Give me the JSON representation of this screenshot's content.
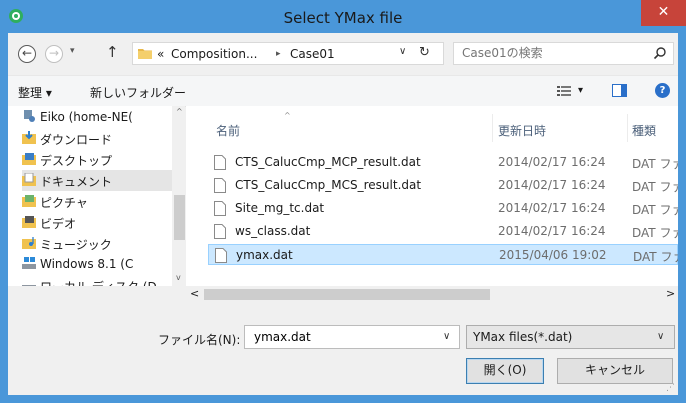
{
  "window": {
    "title": "Select YMax file",
    "close_glyph": "✕",
    "accent": "#4a97d9",
    "close_color": "#c7443a"
  },
  "nav": {
    "back_glyph": "←",
    "forward_glyph": "→",
    "recent_glyph": "▾",
    "up_glyph": "↑"
  },
  "address": {
    "overflow": "«",
    "crumbs": [
      "Composition...",
      "Case01"
    ],
    "separator": "▸",
    "dropdown_glyph": "∨",
    "refresh_glyph": "↻"
  },
  "search": {
    "placeholder": "Case01の検索"
  },
  "command_bar": {
    "organize_label": "整理 ▾",
    "new_folder_label": "新しいフォルダー",
    "view_dropdown_glyph": "▾",
    "help_glyph": "?"
  },
  "sidebar": {
    "items": [
      {
        "label": "Eiko (home-NE(",
        "icon": "network-user-icon"
      },
      {
        "label": "ダウンロード",
        "icon": "downloads-folder-icon"
      },
      {
        "label": "デスクトップ",
        "icon": "desktop-folder-icon"
      },
      {
        "label": "ドキュメント",
        "icon": "documents-folder-icon",
        "selected": true
      },
      {
        "label": "ピクチャ",
        "icon": "pictures-folder-icon"
      },
      {
        "label": "ビデオ",
        "icon": "videos-folder-icon"
      },
      {
        "label": "ミュージック",
        "icon": "music-folder-icon"
      },
      {
        "label": "Windows 8.1 (C",
        "icon": "drive-icon"
      },
      {
        "label": "ローカル ディスク (D",
        "icon": "drive-icon"
      }
    ],
    "scroll_up": "^",
    "scroll_down": "v"
  },
  "file_list": {
    "columns": {
      "name": "名前",
      "date": "更新日時",
      "type": "種類"
    },
    "sort_glyph": "^",
    "files": [
      {
        "name": "CTS_CalucCmp_MCP_result.dat",
        "date": "2014/02/17 16:24",
        "type": "DAT ファイ"
      },
      {
        "name": "CTS_CalucCmp_MCS_result.dat",
        "date": "2014/02/17 16:24",
        "type": "DAT ファイ"
      },
      {
        "name": "Site_mg_tc.dat",
        "date": "2014/02/17 16:24",
        "type": "DAT ファイ"
      },
      {
        "name": "ws_class.dat",
        "date": "2014/02/17 16:24",
        "type": "DAT ファイ"
      },
      {
        "name": "ymax.dat",
        "date": "2015/04/06 19:02",
        "type": "DAT ファイ",
        "selected": true
      }
    ],
    "scroll_left": "<",
    "scroll_right": ">"
  },
  "footer": {
    "filename_label": "ファイル名(N):",
    "filename_value": "ymax.dat",
    "filename_dropdown": "∨",
    "filetype_value": "YMax files(*.dat)",
    "filetype_dropdown": "∨",
    "open_label": "開く(O)",
    "cancel_label": "キャンセル",
    "grip_glyph": "⋰"
  }
}
